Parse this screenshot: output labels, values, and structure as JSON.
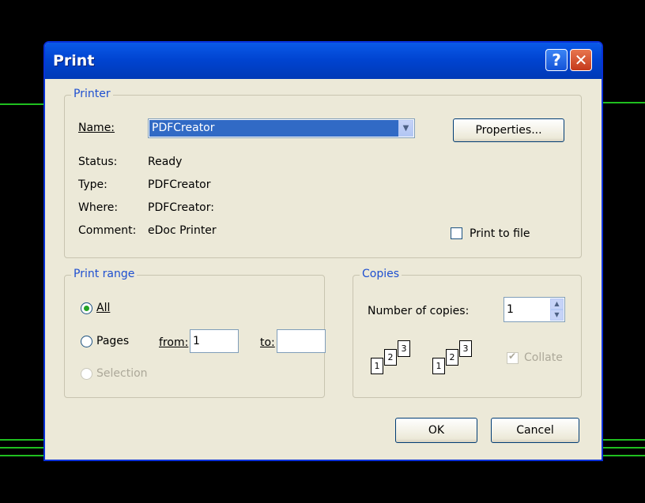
{
  "dialog": {
    "title": "Print",
    "help_glyph": "?",
    "close_glyph": "✕"
  },
  "printer_group": {
    "legend": "Printer",
    "name_label": "Name:",
    "name_value": "PDFCreator",
    "properties_button": "Properties...",
    "status_label": "Status:",
    "status_value": "Ready",
    "type_label": "Type:",
    "type_value": "PDFCreator",
    "where_label": "Where:",
    "where_value": "PDFCreator:",
    "comment_label": "Comment:",
    "comment_value": "eDoc Printer",
    "print_to_file_label": "Print to file",
    "print_to_file_checked": false
  },
  "print_range": {
    "legend": "Print range",
    "all_label": "All",
    "pages_label": "Pages",
    "from_label": "from:",
    "from_value": "1",
    "to_label": "to:",
    "to_value": "",
    "selection_label": "Selection",
    "selected": "All"
  },
  "copies": {
    "legend": "Copies",
    "number_label": "Number of copies:",
    "number_value": "1",
    "collate_label": "Collate",
    "collate_checked": true,
    "collate_enabled": false,
    "page_labels": [
      "1",
      "2",
      "3"
    ]
  },
  "buttons": {
    "ok": "OK",
    "cancel": "Cancel"
  },
  "icons": [
    "help-icon",
    "close-icon",
    "dropdown-arrow-icon",
    "spinner-up-icon",
    "spinner-down-icon",
    "checkmark-icon",
    "collate-pages-icon"
  ]
}
